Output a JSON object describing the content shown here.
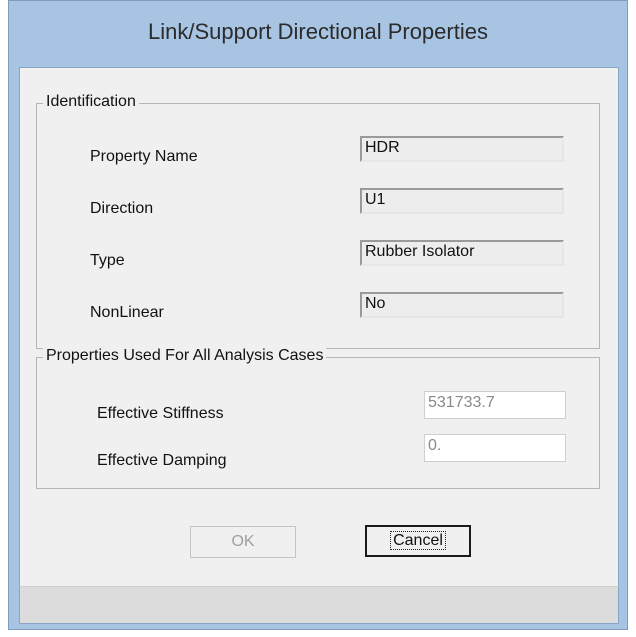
{
  "window": {
    "title": "Link/Support Directional Properties"
  },
  "identification": {
    "legend": "Identification",
    "rows": [
      {
        "label": "Property Name",
        "value": "HDR"
      },
      {
        "label": "Direction",
        "value": "U1"
      },
      {
        "label": "Type",
        "value": "Rubber Isolator"
      },
      {
        "label": "NonLinear",
        "value": "No"
      }
    ]
  },
  "properties": {
    "legend": "Properties Used For All Analysis Cases",
    "effective_stiffness": {
      "label": "Effective Stiffness",
      "value": "531733.7"
    },
    "effective_damping": {
      "label": "Effective Damping",
      "value": "0."
    }
  },
  "buttons": {
    "ok": "OK",
    "cancel": "Cancel"
  }
}
